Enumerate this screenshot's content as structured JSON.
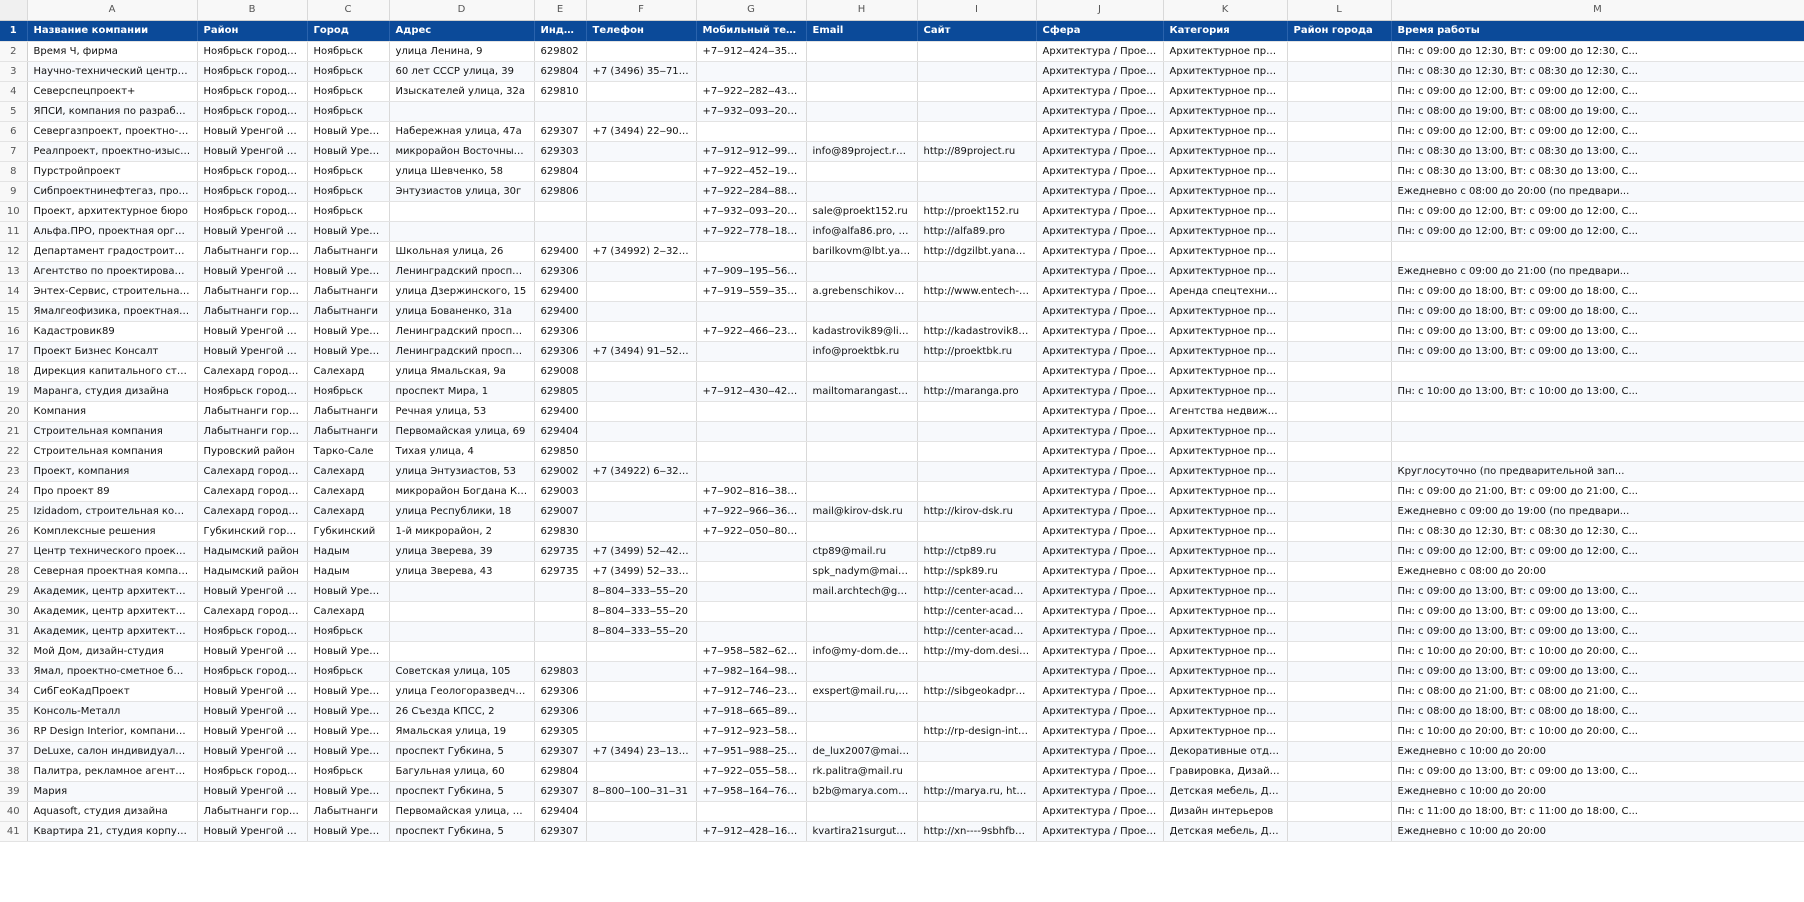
{
  "columns": [
    "A",
    "B",
    "C",
    "D",
    "E",
    "F",
    "G",
    "H",
    "I",
    "J",
    "K",
    "L",
    "M"
  ],
  "header_row_number": "1",
  "headers": [
    "Название компании",
    "Район",
    "Город",
    "Адрес",
    "Индекс",
    "Телефон",
    "Мобильный телефон",
    "Email",
    "Сайт",
    "Сфера",
    "Категория",
    "Район города",
    "Время работы"
  ],
  "rows": [
    [
      "2",
      "Время Ч, фирма",
      "Ноябрьск городской о...",
      "Ноябрьск",
      "улица Ленина, 9",
      "629802",
      "",
      "+7‒912‒424‒35‒17, +7...",
      "",
      "",
      "Архитектура / Проектиров...",
      "Архитектурное проектиро...",
      "",
      "Пн: с 09:00 до 12:30, Вт: с 09:00 до 12:30, С..."
    ],
    [
      "3",
      "Научно-технический центр Система, ...",
      "Ноябрьск городской о...",
      "Ноябрьск",
      "60 лет СССР улица, 39",
      "629804",
      "+7 (3496) 35‒71‒48",
      "",
      "",
      "",
      "Архитектура / Проектиров...",
      "Архитектурное проектиро...",
      "",
      "Пн: с 08:30 до 12:30, Вт: с 08:30 до 12:30, С..."
    ],
    [
      "4",
      "Северспецпроект+",
      "Ноябрьск городской о...",
      "Ноябрьск",
      "Изыскателей улица, 32а",
      "629810",
      "",
      "+7‒922‒282‒43‒59",
      "",
      "",
      "Архитектура / Проектиров...",
      "Архитектурное проектиро...",
      "",
      "Пн: с 09:00 до 12:00, Вт: с 09:00 до 12:00, С..."
    ],
    [
      "5",
      "ЯПСИ, компания по разработке прое...",
      "Ноябрьск городской о...",
      "Ноябрьск",
      "",
      "",
      "",
      "+7‒932‒093‒20‒77",
      "",
      "",
      "Архитектура / Проектиров...",
      "Архитектурное проектиро...",
      "",
      "Пн: с 08:00 до 19:00, Вт: с 08:00 до 19:00, С..."
    ],
    [
      "6",
      "Севергазпроект, проектно-строитель...",
      "Новый Уренгой городс...",
      "Новый Уренгой",
      "Набережная улица, 47а",
      "629307",
      "+7 (3494) 22‒90‒10",
      "",
      "",
      "",
      "Архитектура / Проектиров...",
      "Архитектурное проектиро...",
      "",
      "Пн: с 09:00 до 12:00, Вт: с 09:00 до 12:00, С..."
    ],
    [
      "7",
      "Реалпроект, проектно-изыскательска...",
      "Новый Уренгой городс...",
      "Новый Уренгой",
      "микрорайон Восточный, 2/3",
      "629303",
      "",
      "+7‒912‒912‒99‒33",
      "info@89project.ru, offici...",
      "http://89project.ru",
      "Архитектура / Проектиров...",
      "Архитектурное проектиро...",
      "",
      "Пн: с 08:30 до 13:00, Вт: с 08:30 до 13:00, С..."
    ],
    [
      "8",
      "Пурстройпроект",
      "Ноябрьск городской о...",
      "Ноябрьск",
      "улица Шевченко, 58",
      "629804",
      "",
      "+7‒922‒452‒19‒89",
      "",
      "",
      "Архитектура / Проектиров...",
      "Архитектурное проектиро...",
      "",
      "Пн: с 08:30 до 13:00, Вт: с 08:30 до 13:00, С..."
    ],
    [
      "9",
      "Сибпроектнинефтегаз, проектная ко...",
      "Ноябрьск городской о...",
      "Ноябрьск",
      "Энтузиастов улица, 30г",
      "629806",
      "",
      "+7‒922‒284‒88‒88",
      "",
      "",
      "Архитектура / Проектиров...",
      "Архитектурное проектиро...",
      "",
      "Ежедневно с 08:00 до 20:00 (по предвари..."
    ],
    [
      "10",
      "Проект, архитектурное бюро",
      "Ноябрьск городской о...",
      "Ноябрьск",
      "",
      "",
      "",
      "+7‒932‒093‒20‒77",
      "sale@proekt152.ru",
      "http://proekt152.ru",
      "Архитектура / Проектиров...",
      "Архитектурное проектиро...",
      "",
      "Пн: с 09:00 до 12:00, Вт: с 09:00 до 12:00, С..."
    ],
    [
      "11",
      "Альфа.ПРО, проектная организация и...",
      "Новый Уренгой городс...",
      "Новый Уренгой",
      "",
      "",
      "",
      "+7‒922‒778‒18‒48",
      "info@alfa86.pro, info@...",
      "http://alfa89.pro",
      "Архитектура / Проектиров...",
      "Архитектурное проектиро...",
      "",
      "Пн: с 09:00 до 12:00, Вт: с 09:00 до 12:00, С..."
    ],
    [
      "12",
      "Департамент градостроительства, зе...",
      "Лабытнанги городской...",
      "Лабытнанги",
      "Школьная улица, 26",
      "629400",
      "+7 (34992) 2‒32‒92, +7...",
      "",
      "barilkovm@lbt.yanao, c...",
      "http://dgzilbt.yanao.ru",
      "Архитектура / Проектиров...",
      "Архитектурное проектиро...",
      "",
      ""
    ],
    [
      "13",
      "Агентство по проектированию и суде...",
      "Новый Уренгой городс...",
      "Новый Уренгой",
      "Ленинградский проспект, 1",
      "629306",
      "",
      "+7‒909‒195‒56‒64",
      "",
      "",
      "Архитектура / Проектиров...",
      "Архитектурное проектиро...",
      "",
      "Ежедневно с 09:00 до 21:00 (по предвари..."
    ],
    [
      "14",
      "Энтех-Сервис, строительная компания",
      "Лабытнанги городской...",
      "Лабытнанги",
      "улица Дзержинского, 15",
      "629400",
      "",
      "+7‒919‒559‒35‒50",
      "a.grebenschikov@entec...",
      "http://www.entech-group....",
      "Архитектура / Проектиров...",
      "Аренда спецтехники, Архи...",
      "",
      "Пн: с 09:00 до 18:00, Вт: с 09:00 до 18:00, С..."
    ],
    [
      "15",
      "Ямалгеофизика, проектная организац...",
      "Лабытнанги городской...",
      "Лабытнанги",
      "улица Бованенко, 31а",
      "629400",
      "",
      "",
      "",
      "",
      "Архитектура / Проектиров...",
      "Архитектурное проектиро...",
      "",
      "Пн: с 09:00 до 18:00, Вт: с 09:00 до 18:00, С..."
    ],
    [
      "16",
      "Кадастровик89",
      "Новый Уренгой городс...",
      "Новый Уренгой",
      "Ленинградский проспект, 1",
      "629306",
      "",
      "+7‒922‒466‒23‒11",
      "kadastrovik89@list.ru, k...",
      "http://kadastrovik89.ru",
      "Архитектура / Проектиров...",
      "Архитектурное проектиро...",
      "",
      "Пн: с 09:00 до 13:00, Вт: с 09:00 до 13:00, С..."
    ],
    [
      "17",
      "Проект Бизнес Консалт",
      "Новый Уренгой городс...",
      "Новый Уренгой",
      "Ленинградский проспект, 4",
      "629306",
      "+7 (3494) 91‒52‒52",
      "",
      "info@proektbk.ru",
      "http://proektbk.ru",
      "Архитектура / Проектиров...",
      "Архитектурное проектиро...",
      "",
      "Пн: с 09:00 до 13:00, Вт: с 09:00 до 13:00, С..."
    ],
    [
      "18",
      "Дирекция капитального строительств...",
      "Салехард городской о...",
      "Салехард",
      "улица Ямальская, 9а",
      "629008",
      "",
      "",
      "",
      "",
      "Архитектура / Проектиров...",
      "Архитектурное проектиро...",
      "",
      ""
    ],
    [
      "19",
      "Маранга, студия дизайна",
      "Ноябрьск городской о...",
      "Ноябрьск",
      "проспект Мира, 1",
      "629805",
      "",
      "+7‒912‒430‒42‒14",
      "mailtomarangastudia@...",
      "http://maranga.pro",
      "Архитектура / Проектиров...",
      "Архитектурное проектиро...",
      "",
      "Пн: с 10:00 до 13:00, Вт: с 10:00 до 13:00, С..."
    ],
    [
      "20",
      "Компания",
      "Лабытнанги городской...",
      "Лабытнанги",
      "Речная улица, 53",
      "629400",
      "",
      "",
      "",
      "",
      "Архитектура / Проектиров...",
      "Агентства недвижимости, ...",
      "",
      ""
    ],
    [
      "21",
      "Строительная компания",
      "Лабытнанги городской...",
      "Лабытнанги",
      "Первомайская улица, 69",
      "629404",
      "",
      "",
      "",
      "",
      "Архитектура / Проектиров...",
      "Архитектурное проектиро...",
      "",
      ""
    ],
    [
      "22",
      "Строительная компания",
      "Пуровский район",
      "Тарко-Сале",
      "Тихая улица, 4",
      "629850",
      "",
      "",
      "",
      "",
      "Архитектура / Проектиров...",
      "Архитектурное проектиро...",
      "",
      ""
    ],
    [
      "23",
      "Проект, компания",
      "Салехард городской о...",
      "Салехард",
      "улица Энтузиастов, 53",
      "629002",
      "+7 (34922) 6‒32‒24",
      "",
      "",
      "",
      "Архитектура / Проектиров...",
      "Архитектурное проектиро...",
      "",
      "Круглосуточно (по предварительной зап..."
    ],
    [
      "24",
      "Про проект 89",
      "Салехард городской о...",
      "Салехард",
      "микрорайон Богдана Кнунянц...",
      "629003",
      "",
      "+7‒902‒816‒38‒63",
      "",
      "",
      "Архитектура / Проектиров...",
      "Архитектурное проектиро...",
      "",
      "Пн: с 09:00 до 21:00, Вт: с 09:00 до 21:00, С..."
    ],
    [
      "25",
      "Izidadom, строительная компания",
      "Салехард городской о...",
      "Салехард",
      "улица Республики, 18",
      "629007",
      "",
      "+7‒922‒966‒36‒36",
      "mail@kirov-dsk.ru",
      "http://kirov-dsk.ru",
      "Архитектура / Проектиров...",
      "Архитектурное проектиро...",
      "",
      "Ежедневно с 09:00 до 19:00 (по предвари..."
    ],
    [
      "26",
      "Комплексные решения",
      "Губкинский городской...",
      "Губкинский",
      "1-й микрорайон, 2",
      "629830",
      "",
      "+7‒922‒050‒80‒21",
      "",
      "",
      "Архитектура / Проектиров...",
      "Архитектурное проектиро...",
      "",
      "Пн: с 08:30 до 12:30, Вт: с 08:30 до 12:30, С..."
    ],
    [
      "27",
      "Центр технического проектирования",
      "Надымский район",
      "Надым",
      "улица Зверева, 39",
      "629735",
      "+7 (3499) 52‒42‒82, +7...",
      "",
      "ctp89@mail.ru",
      "http://ctp89.ru",
      "Архитектура / Проектиров...",
      "Архитектурное проектиро...",
      "",
      "Пн: с 09:00 до 12:00, Вт: с 09:00 до 12:00, С..."
    ],
    [
      "28",
      "Северная проектная компания",
      "Надымский район",
      "Надым",
      "улица Зверева, 43",
      "629735",
      "+7 (3499) 52‒33‒38",
      "",
      "spk_nadym@mail.ru",
      "http://spk89.ru",
      "Архитектура / Проектиров...",
      "Архитектурное проектиро...",
      "",
      "Ежедневно с 08:00 до 20:00"
    ],
    [
      "29",
      "Академик, центр архитектурного про...",
      "Новый Уренгой городс...",
      "Новый Уренгой",
      "",
      "",
      "8‒804‒333‒55‒20",
      "",
      "mail.archtech@gmail.com",
      "http://center-academic.ru,...",
      "Архитектура / Проектиров...",
      "Архитектурное проектиро...",
      "",
      "Пн: с 09:00 до 13:00, Вт: с 09:00 до 13:00, С..."
    ],
    [
      "30",
      "Академик, центр архитектурного про...",
      "Салехард городской о...",
      "Салехард",
      "",
      "",
      "8‒804‒333‒55‒20",
      "",
      "",
      "http://center-academic.ru,...",
      "Архитектура / Проектиров...",
      "Архитектурное проектиро...",
      "",
      "Пн: с 09:00 до 13:00, Вт: с 09:00 до 13:00, С..."
    ],
    [
      "31",
      "Академик, центр архитектурного про...",
      "Ноябрьск городской о...",
      "Ноябрьск",
      "",
      "",
      "8‒804‒333‒55‒20",
      "",
      "",
      "http://center-academic.ru,...",
      "Архитектура / Проектиров...",
      "Архитектурное проектиро...",
      "",
      "Пн: с 09:00 до 13:00, Вт: с 09:00 до 13:00, С..."
    ],
    [
      "32",
      "Мой Дом, дизайн-студия",
      "Новый Уренгой городс...",
      "Новый Уренгой",
      "",
      "",
      "",
      "+7‒958‒582‒62‒73",
      "info@my-dom.design, o...",
      "http://my-dom.design",
      "Архитектура / Проектиров...",
      "Архитектурное проектиро...",
      "",
      "Пн: с 10:00 до 20:00, Вт: с 10:00 до 20:00, С..."
    ],
    [
      "33",
      "Ямал, проектно-сметное бюро",
      "Ноябрьск городской о...",
      "Ноябрьск",
      "Советская улица, 105",
      "629803",
      "",
      "+7‒982‒164‒98‒26",
      "",
      "",
      "Архитектура / Проектиров...",
      "Архитектурное проектиро...",
      "",
      "Пн: с 09:00 до 13:00, Вт: с 09:00 до 13:00, С..."
    ],
    [
      "34",
      "СибГеоКадПроект",
      "Новый Уренгой городс...",
      "Новый Уренгой",
      "улица Геологоразведчиков, 2",
      "629306",
      "",
      "+7‒912‒746‒23‒76",
      "exspert@mail.ru, sibgeo...",
      "http://sibgeokadproekt.ru",
      "Архитектура / Проектиров...",
      "Архитектурное проектиро...",
      "",
      "Пн: с 08:00 до 21:00, Вт: с 08:00 до 21:00, С..."
    ],
    [
      "35",
      "Консоль-Металл",
      "Новый Уренгой городс...",
      "Новый Уренгой",
      "26 Съезда КПСС, 2",
      "629306",
      "",
      "+7‒918‒665‒89‒89, +7...",
      "",
      "",
      "Архитектура / Проектиров...",
      "Архитектурное проектиро...",
      "",
      "Пн: с 08:00 до 18:00, Вт: с 08:00 до 18:00, С..."
    ],
    [
      "36",
      "RP Design Interior, компания по услуг...",
      "Новый Уренгой городс...",
      "Новый Уренгой",
      "Ямальская улица, 19",
      "629305",
      "",
      "+7‒912‒923‒58‒83",
      "",
      "http://rp-design-interior.ru",
      "Архитектура / Проектиров...",
      "Архитектурное проектиро...",
      "",
      "Пн: с 10:00 до 20:00, Вт: с 10:00 до 20:00, С..."
    ],
    [
      "37",
      "DeLuxe, салон индивидуального деко...",
      "Новый Уренгой городс...",
      "Новый Уренгой",
      "проспект Губкина, 5",
      "629307",
      "+7 (3494) 23‒13‒79",
      "+7‒951‒988‒25‒66",
      "de_lux2007@mail.ru",
      "",
      "Архитектура / Проектиров...",
      "Декоративные отделочны...",
      "",
      "Ежедневно с 10:00 до 20:00"
    ],
    [
      "38",
      "Палитра, рекламное агентство полно...",
      "Ноябрьск городской о...",
      "Ноябрьск",
      "Багульная улица, 60",
      "629804",
      "",
      "+7‒922‒055‒58‒73",
      "rk.palitra@mail.ru",
      "",
      "Архитектура / Проектиров...",
      "Гравировка, Дизайн интер...",
      "",
      "Пн: с 09:00 до 13:00, Вт: с 09:00 до 13:00, С..."
    ],
    [
      "39",
      "Мария",
      "Новый Уренгой городс...",
      "Новый Уренгой",
      "проспект Губкина, 5",
      "629307",
      "8‒800‒100‒31‒31",
      "+7‒958‒164‒76‒63",
      "b2b@marya.com, o-min...",
      "http://marya.ru, http://no...",
      "Архитектура / Проектиров...",
      "Детская мебель, Дизайн и...",
      "",
      "Ежедневно с 10:00 до 20:00"
    ],
    [
      "40",
      "Aquasoft, студия дизайна",
      "Лабытнанги городской...",
      "Лабытнанги",
      "Первомайская улица, 67а",
      "629404",
      "",
      "",
      "",
      "",
      "Архитектура / Проектиров...",
      "Дизайн интерьеров",
      "",
      "Пн: с 11:00 до 18:00, Вт: с 11:00 до 18:00, С..."
    ],
    [
      "41",
      "Квартира 21, студия корпусной мебели",
      "Новый Уренгой городс...",
      "Новый Уренгой",
      "проспект Губкина, 5",
      "629307",
      "",
      "+7‒912‒428‒16‒64",
      "kvartira21surgut@mail.r...",
      "http://xn----9sbhfbb3amf...",
      "Архитектура / Проектиров...",
      "Детская мебель, Дизайн и...",
      "",
      "Ежедневно с 10:00 до 20:00"
    ]
  ]
}
